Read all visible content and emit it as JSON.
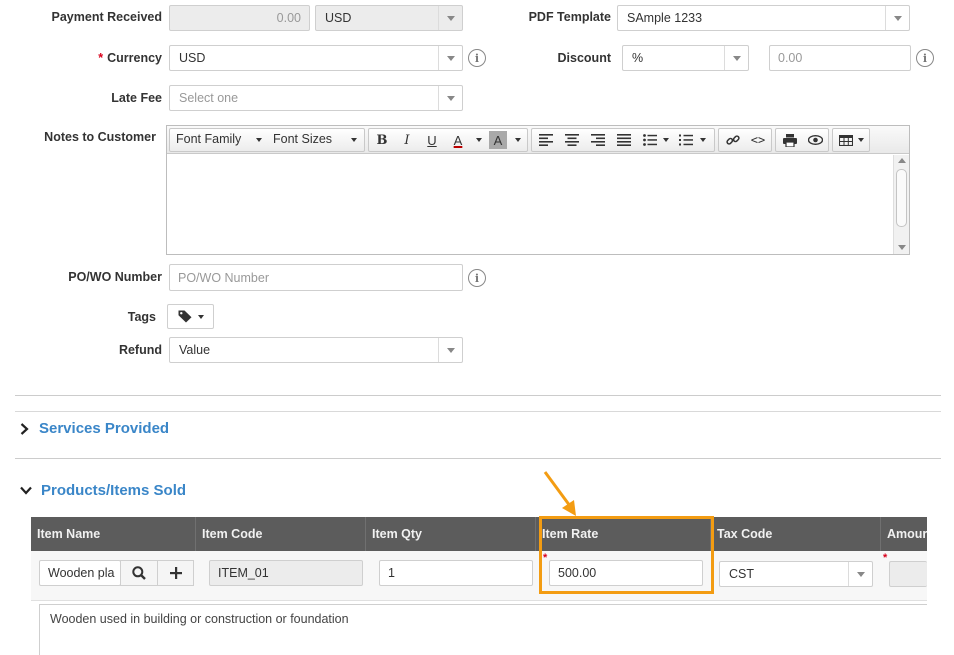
{
  "form": {
    "payment_received": {
      "label": "Payment Received",
      "value": "0.00",
      "currency": "USD"
    },
    "pdf_template": {
      "label": "PDF Template",
      "value": "SAmple 1233"
    },
    "currency": {
      "required_mark": "*",
      "label": "Currency",
      "value": "USD"
    },
    "discount": {
      "label": "Discount",
      "type_value": "%",
      "amount_placeholder": "0.00"
    },
    "late_fee": {
      "label": "Late Fee",
      "placeholder": "Select one"
    },
    "notes": {
      "label": "Notes to Customer"
    },
    "po_wo": {
      "label": "PO/WO Number",
      "placeholder": "PO/WO Number"
    },
    "tags": {
      "label": "Tags"
    },
    "refund": {
      "label": "Refund",
      "value": "Value"
    }
  },
  "editor_toolbar": {
    "font_family": "Font Family",
    "font_sizes": "Font Sizes",
    "bold": "B",
    "italic": "I",
    "underline": "U",
    "font_color": "A",
    "bg_color": "A"
  },
  "sections": {
    "services": "Services Provided",
    "products": "Products/Items Sold"
  },
  "items_table": {
    "columns": [
      "Item Name",
      "Item Code",
      "Item Qty",
      "Item Rate",
      "Tax Code",
      "Amour"
    ],
    "row": {
      "item_name": "Wooden pla",
      "item_code": "ITEM_01",
      "item_qty": "1",
      "rate_required": "*",
      "item_rate": "500.00",
      "tax_code": "CST",
      "amount_required": "*"
    },
    "description": "Wooden used in building or construction or foundation"
  },
  "colors": {
    "accent_link": "#3a86c8",
    "highlight_orange": "#f39c12",
    "table_header": "#5c5c5c",
    "required": "#d9001b"
  }
}
